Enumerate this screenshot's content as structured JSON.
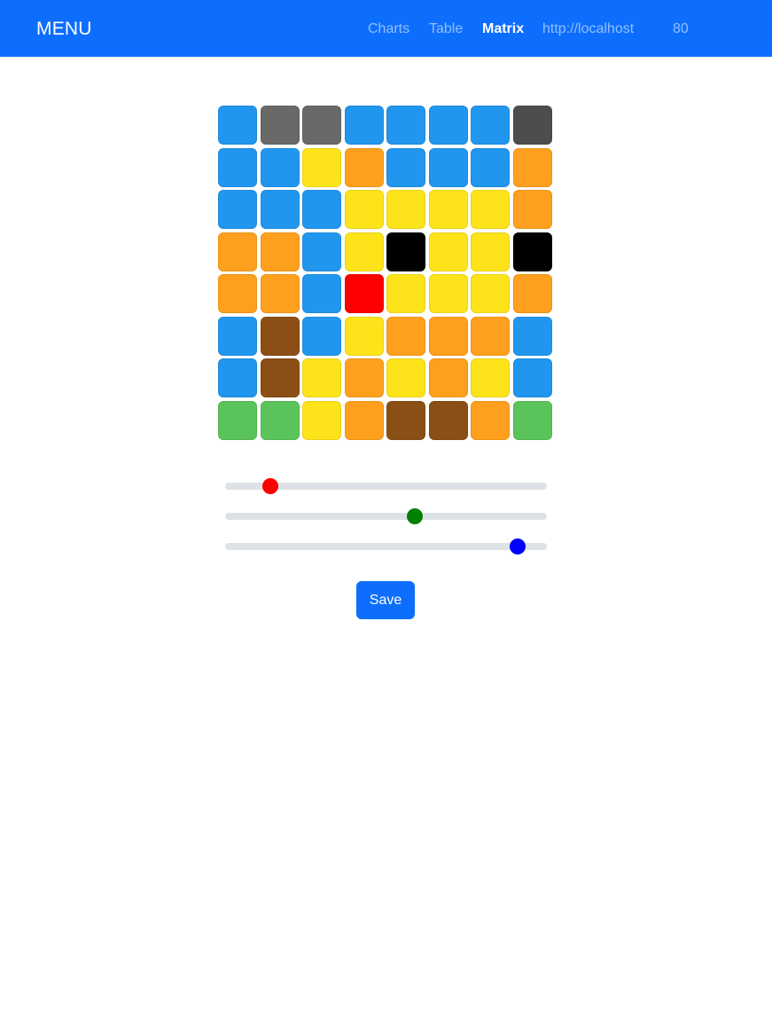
{
  "navbar": {
    "brand": "MENU",
    "items": [
      {
        "label": "Charts",
        "active": false
      },
      {
        "label": "Table",
        "active": false
      },
      {
        "label": "Matrix",
        "active": true
      },
      {
        "label": "http://localhost",
        "active": false
      },
      {
        "label": "80",
        "active": false
      }
    ]
  },
  "palette": {
    "B": "#2196ee",
    "g": "#696969",
    "k": "#4d4d4d",
    "Y": "#fde41a",
    "O": "#fea01d",
    "X": "#000000",
    "R": "#ff0000",
    "W": "#8b4f16",
    "G": "#5ac45a"
  },
  "matrix": [
    [
      "B",
      "g",
      "g",
      "B",
      "B",
      "B",
      "B",
      "k"
    ],
    [
      "B",
      "B",
      "Y",
      "O",
      "B",
      "B",
      "B",
      "O"
    ],
    [
      "B",
      "B",
      "B",
      "Y",
      "Y",
      "Y",
      "Y",
      "O"
    ],
    [
      "O",
      "O",
      "B",
      "Y",
      "X",
      "Y",
      "Y",
      "X"
    ],
    [
      "O",
      "O",
      "B",
      "R",
      "Y",
      "Y",
      "Y",
      "O"
    ],
    [
      "B",
      "W",
      "B",
      "Y",
      "O",
      "O",
      "O",
      "B"
    ],
    [
      "B",
      "W",
      "Y",
      "O",
      "Y",
      "O",
      "Y",
      "B"
    ],
    [
      "G",
      "G",
      "Y",
      "O",
      "W",
      "W",
      "O",
      "G"
    ]
  ],
  "sliders": [
    {
      "name": "red",
      "color": "#ff0000",
      "value": 0.14
    },
    {
      "name": "green",
      "color": "#008000",
      "value": 0.59
    },
    {
      "name": "blue",
      "color": "#0000ff",
      "value": 0.91
    }
  ],
  "save_label": "Save"
}
